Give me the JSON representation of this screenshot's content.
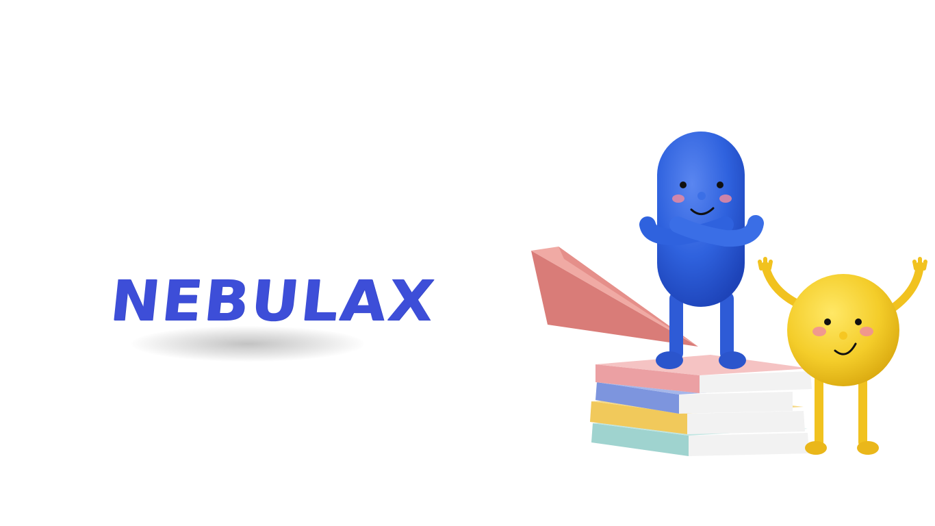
{
  "brand": {
    "name": "NEBULAX"
  },
  "colors": {
    "brand_blue": "#3d4ed8",
    "character_blue": "#2f62de",
    "character_yellow": "#f4cd2a",
    "paper_plane": "#e58f8a",
    "background": "#ffffff"
  },
  "illustration": {
    "elements": [
      "paper-plane-icon",
      "blue-pill-character-icon",
      "yellow-ball-character-icon",
      "book-stack-icon"
    ]
  }
}
